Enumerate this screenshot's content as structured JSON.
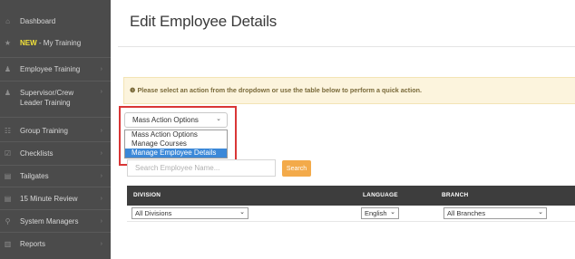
{
  "sidebar": {
    "items": [
      {
        "label": "Dashboard",
        "icon": "home-icon",
        "glyph": "⌂",
        "has_chevron": false
      },
      {
        "label": "- My Training",
        "new_tag": "NEW",
        "icon": "star-icon",
        "glyph": "★",
        "has_chevron": false
      },
      {
        "label": "Employee Training",
        "icon": "person-icon",
        "glyph": "♟",
        "has_chevron": true
      },
      {
        "label": "Supervisor/Crew Leader Training",
        "icon": "person-icon",
        "glyph": "♟",
        "has_chevron": true
      },
      {
        "label": "Group Training",
        "icon": "group-icon",
        "glyph": "☷",
        "has_chevron": true
      },
      {
        "label": "Checklists",
        "icon": "checklist-icon",
        "glyph": "☑",
        "has_chevron": true
      },
      {
        "label": "Tailgates",
        "icon": "document-icon",
        "glyph": "▤",
        "has_chevron": true
      },
      {
        "label": "15 Minute Review",
        "icon": "document-icon",
        "glyph": "▤",
        "has_chevron": true
      },
      {
        "label": "System Managers",
        "icon": "sitemap-icon",
        "glyph": "⚲",
        "has_chevron": true
      },
      {
        "label": "Reports",
        "icon": "chart-icon",
        "glyph": "▥",
        "has_chevron": true
      }
    ],
    "chevron": "›"
  },
  "main": {
    "title": "Edit Employee Details",
    "info": {
      "icon": "info-icon",
      "glyph": "❶",
      "text": "Please select an action from the dropdown or use the table below to perform a quick action."
    },
    "mass_action": {
      "selected": "Mass Action Options",
      "arrow": "⌄",
      "options": [
        "Mass Action Options",
        "Manage Courses",
        "Manage Employee Details"
      ],
      "highlighted_index": 2
    },
    "search": {
      "placeholder": "Search Employee Name...",
      "button_label": "Search"
    },
    "table": {
      "headers": [
        "DIVISION",
        "LANGUAGE",
        "BRANCH"
      ],
      "filters": [
        {
          "value": "All Divisions",
          "arrow": "⌄"
        },
        {
          "value": "English",
          "arrow": "⌄"
        },
        {
          "value": "All Branches",
          "arrow": "⌄"
        }
      ]
    }
  },
  "colors": {
    "sidebar_bg": "#4b4b4b",
    "highlight_border": "#d93636",
    "search_button": "#f3aa4a",
    "table_header": "#3d3d3d",
    "selected_option": "#3b88d8",
    "info_bg": "#fcf4dd"
  }
}
